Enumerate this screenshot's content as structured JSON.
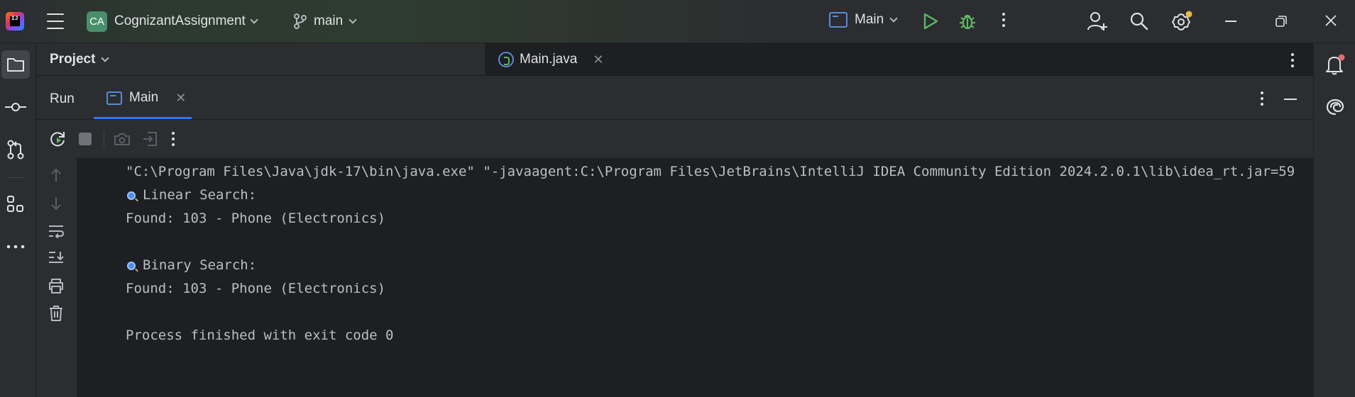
{
  "titlebar": {
    "project_initials": "CA",
    "project_name": "CognizantAssignment",
    "branch": "main",
    "run_config": "Main"
  },
  "project_panel": {
    "title": "Project"
  },
  "editor": {
    "tabs": [
      {
        "label": "Main.java"
      }
    ]
  },
  "run_panel": {
    "title": "Run",
    "tabs": [
      {
        "label": "Main"
      }
    ]
  },
  "console": {
    "lines": [
      "\"C:\\Program Files\\Java\\jdk-17\\bin\\java.exe\" \"-javaagent:C:\\Program Files\\JetBrains\\IntelliJ IDEA Community Edition 2024.2.0.1\\lib\\idea_rt.jar=59",
      "Linear Search:",
      "Found: 103 - Phone (Electronics)",
      "Binary Search:",
      "Found: 103 - Phone (Electronics)",
      "Process finished with exit code 0"
    ]
  },
  "colors": {
    "accent": "#3574f0",
    "run_green": "#5fb865",
    "background": "#1e1f22",
    "panel": "#2b2d30",
    "badge_green": "#4a8f6d",
    "notification_dot": "#e8b84e"
  },
  "icons": [
    "ide-logo",
    "hamburger-icon",
    "branch-icon",
    "run-config-icon",
    "run-icon",
    "debug-icon",
    "more-icon",
    "add-user-icon",
    "search-icon",
    "settings-icon",
    "minimize-icon",
    "restore-icon",
    "close-icon",
    "folder-icon",
    "commit-icon",
    "pull-request-icon",
    "structure-icon",
    "more-tools-icon",
    "notifications-icon",
    "ai-assistant-icon",
    "rerun-icon",
    "stop-icon",
    "screenshot-icon",
    "exit-icon",
    "up-arrow-icon",
    "down-arrow-icon",
    "soft-wrap-icon",
    "scroll-to-end-icon",
    "print-icon",
    "trash-icon"
  ]
}
